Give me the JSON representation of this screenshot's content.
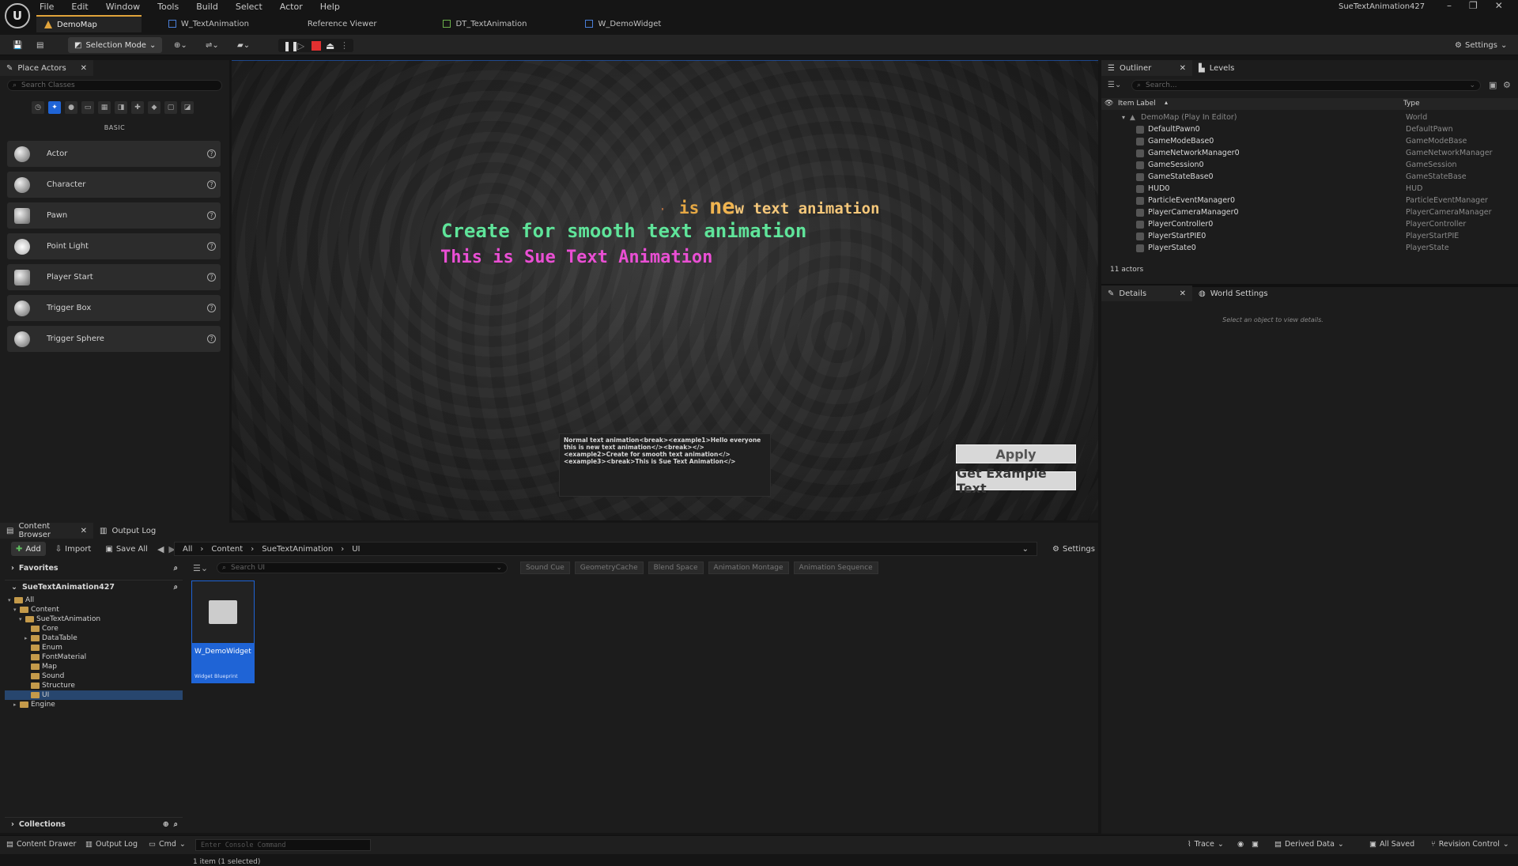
{
  "app": {
    "project_name": "SueTextAnimation427",
    "menu": [
      "File",
      "Edit",
      "Window",
      "Tools",
      "Build",
      "Select",
      "Actor",
      "Help"
    ],
    "tabs": [
      {
        "label": "DemoMap",
        "active": true
      },
      {
        "label": "W_TextAnimation",
        "active": false
      },
      {
        "label": "Reference Viewer",
        "active": false
      },
      {
        "label": "DT_TextAnimation",
        "active": false
      },
      {
        "label": "W_DemoWidget",
        "active": false
      }
    ],
    "accent_color": "#e0a33b",
    "selection_color": "#1f64d6"
  },
  "toolbar": {
    "selection_mode": "Selection Mode",
    "settings_label": "Settings"
  },
  "place_actors": {
    "tab_label": "Place Actors",
    "search_placeholder": "Search Classes",
    "category_label": "BASIC",
    "items": [
      "Actor",
      "Character",
      "Pawn",
      "Point Light",
      "Player Start",
      "Trigger Box",
      "Trigger Sphere"
    ]
  },
  "viewport": {
    "line1": {
      "prefix": "'",
      "part_a": "is",
      "part_b": "ne",
      "part_c": "w text animation"
    },
    "line2": "Create for smooth text animation",
    "line3": "This is Sue Text Animation",
    "input_text": "Normal text animation<break><example1>Hello everyone this is new text animation</><break></><example2>Create for smooth text animation</><example3><break>This is Sue Text Animation</>",
    "apply_label": "Apply",
    "get_example_label": "Get Example Text",
    "line_colors": {
      "line1": "#e6a844",
      "line2": "#5fe49a",
      "line3": "#ea4fd4"
    }
  },
  "outliner": {
    "tab_label": "Outliner",
    "levels_tab": "Levels",
    "search_placeholder": "Search...",
    "col_label": "Item Label",
    "col_type": "Type",
    "root": {
      "label": "DemoMap (Play In Editor)",
      "type": "World"
    },
    "rows": [
      {
        "label": "DefaultPawn0",
        "type": "DefaultPawn"
      },
      {
        "label": "GameModeBase0",
        "type": "GameModeBase"
      },
      {
        "label": "GameNetworkManager0",
        "type": "GameNetworkManager"
      },
      {
        "label": "GameSession0",
        "type": "GameSession"
      },
      {
        "label": "GameStateBase0",
        "type": "GameStateBase"
      },
      {
        "label": "HUD0",
        "type": "HUD"
      },
      {
        "label": "ParticleEventManager0",
        "type": "ParticleEventManager"
      },
      {
        "label": "PlayerCameraManager0",
        "type": "PlayerCameraManager"
      },
      {
        "label": "PlayerController0",
        "type": "PlayerController"
      },
      {
        "label": "PlayerStartPIE0",
        "type": "PlayerStartPIE"
      },
      {
        "label": "PlayerState0",
        "type": "PlayerState"
      }
    ],
    "count": "11 actors"
  },
  "details": {
    "tab_label": "Details",
    "world_settings_tab": "World Settings",
    "empty_text": "Select an object to view details."
  },
  "content_browser": {
    "tab_label": "Content Browser",
    "output_log_tab": "Output Log",
    "add_label": "Add",
    "import_label": "Import",
    "save_all_label": "Save All",
    "breadcrumb": [
      "All",
      "Content",
      "SueTextAnimation",
      "UI"
    ],
    "settings_label": "Settings",
    "favorites_label": "Favorites",
    "project_label": "SueTextAnimation427",
    "tree": [
      {
        "label": "All",
        "depth": 0,
        "selected": false
      },
      {
        "label": "Content",
        "depth": 1,
        "selected": false
      },
      {
        "label": "SueTextAnimation",
        "depth": 2,
        "selected": false
      },
      {
        "label": "Core",
        "depth": 3,
        "selected": false
      },
      {
        "label": "DataTable",
        "depth": 3,
        "selected": false
      },
      {
        "label": "Enum",
        "depth": 3,
        "selected": false
      },
      {
        "label": "FontMaterial",
        "depth": 3,
        "selected": false
      },
      {
        "label": "Map",
        "depth": 3,
        "selected": false
      },
      {
        "label": "Sound",
        "depth": 3,
        "selected": false
      },
      {
        "label": "Structure",
        "depth": 3,
        "selected": false
      },
      {
        "label": "UI",
        "depth": 3,
        "selected": true
      },
      {
        "label": "Engine",
        "depth": 1,
        "selected": false
      }
    ],
    "collections_label": "Collections",
    "search_placeholder": "Search UI",
    "filter_chips": [
      "Sound Cue",
      "GeometryCache",
      "Blend Space",
      "Animation Montage",
      "Animation Sequence"
    ],
    "asset": {
      "name": "W_DemoWidget",
      "type": "Widget Blueprint"
    },
    "status": "1 item (1 selected)"
  },
  "statusbar": {
    "content_drawer": "Content Drawer",
    "output_log": "Output Log",
    "cmd": "Cmd",
    "console_placeholder": "Enter Console Command",
    "trace": "Trace",
    "derived_data": "Derived Data",
    "all_saved": "All Saved",
    "revision_control": "Revision Control"
  }
}
